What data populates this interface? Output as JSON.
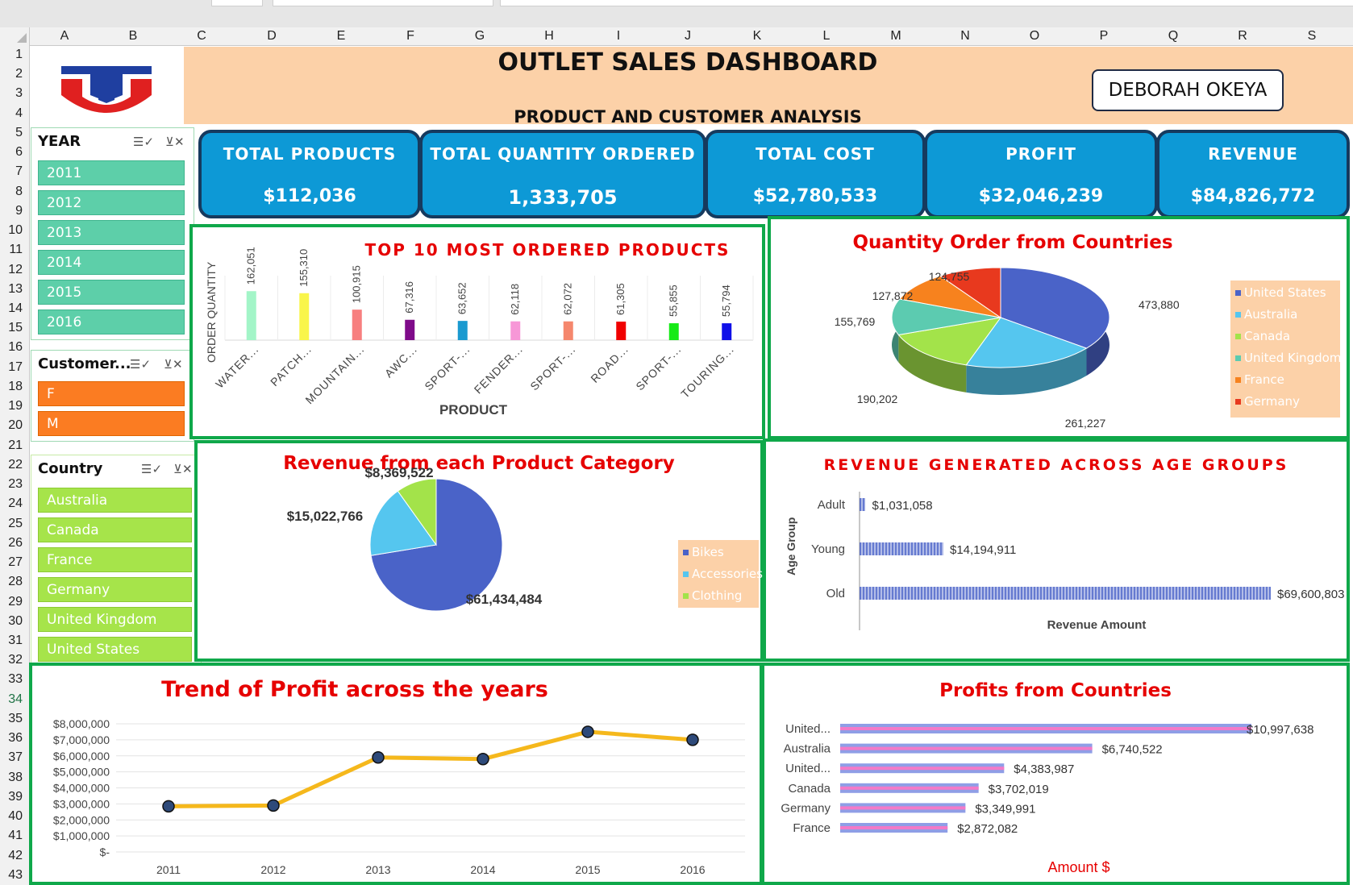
{
  "spreadsheet": {
    "columns": [
      "A",
      "B",
      "C",
      "D",
      "E",
      "F",
      "G",
      "H",
      "I",
      "J",
      "K",
      "L",
      "M",
      "N",
      "O",
      "P",
      "Q",
      "R",
      "S"
    ],
    "rows": [
      "1",
      "2",
      "3",
      "4",
      "5",
      "6",
      "7",
      "8",
      "9",
      "10",
      "11",
      "12",
      "13",
      "14",
      "15",
      "16",
      "17",
      "18",
      "19",
      "20",
      "21",
      "22",
      "23",
      "24",
      "25",
      "26",
      "27",
      "28",
      "29",
      "30",
      "31",
      "32",
      "33",
      "34",
      "35",
      "36",
      "37",
      "38",
      "39",
      "40",
      "41",
      "42",
      "43"
    ],
    "selected_row": "34"
  },
  "header": {
    "title": "OUTLET SALES DASHBOARD",
    "subtitle": "PRODUCT AND CUSTOMER ANALYSIS",
    "author": "DEBORAH OKEYA",
    "band_color": "#fcd1a8"
  },
  "kpis": [
    {
      "label": "TOTAL PRODUCTS",
      "value": "$112,036"
    },
    {
      "label": "TOTAL QUANTITY ORDERED",
      "value": "1,333,705"
    },
    {
      "label": "TOTAL COST",
      "value": "$52,780,533"
    },
    {
      "label": "PROFIT",
      "value": "$32,046,239"
    },
    {
      "label": "REVENUE",
      "value": "$84,826,772"
    }
  ],
  "slicers": {
    "year": {
      "title": "YEAR",
      "items": [
        "2011",
        "2012",
        "2013",
        "2014",
        "2015",
        "2016"
      ]
    },
    "gender": {
      "title": "Customer...",
      "items": [
        "F",
        "M"
      ]
    },
    "country": {
      "title": "Country",
      "items": [
        "Australia",
        "Canada",
        "France",
        "Germany",
        "United Kingdom",
        "United States"
      ]
    },
    "icons": [
      "multi-select-icon",
      "clear-filter-icon"
    ]
  },
  "chart_data": [
    {
      "type": "bar",
      "title": "TOP 10 MOST ORDERED PRODUCTS",
      "xlabel": "PRODUCT",
      "ylabel": "ORDER QUANTITY",
      "categories": [
        "WATER...",
        "PATCH...",
        "MOUNTAIN...",
        "AWC...",
        "SPORT-...",
        "FENDER...",
        "SPORT-...",
        "ROAD...",
        "SPORT-...",
        "TOURING..."
      ],
      "values": [
        162051,
        155310,
        100915,
        67316,
        63652,
        62118,
        62072,
        61305,
        55855,
        55794
      ],
      "value_labels": [
        "162,051",
        "155,310",
        "100,915",
        "67,316",
        "63,652",
        "62,118",
        "62,072",
        "61,305",
        "55,855",
        "55,794"
      ],
      "colors": [
        "#a3f5c8",
        "#f9f54a",
        "#f77f7f",
        "#7f0b8a",
        "#1a9ad0",
        "#f797d7",
        "#f5876d",
        "#f00000",
        "#15ea15",
        "#1010e8"
      ],
      "ylim": [
        0,
        180000
      ]
    },
    {
      "type": "pie",
      "title": "Quantity Order from Countries",
      "series": [
        {
          "name": "United States",
          "value": 473880,
          "label": "473,880",
          "color": "#4a63c8"
        },
        {
          "name": "Australia",
          "value": 261227,
          "label": "261,227",
          "color": "#55c6ef"
        },
        {
          "name": "Canada",
          "value": 190202,
          "label": "190,202",
          "color": "#a3e34a"
        },
        {
          "name": "United Kingdom",
          "value": 155769,
          "label": "155,769",
          "color": "#5ccbb0"
        },
        {
          "name": "France",
          "value": 127872,
          "label": "127,872",
          "color": "#f7821e"
        },
        {
          "name": "Germany",
          "value": 124755,
          "label": "124,755",
          "color": "#e8391e"
        }
      ],
      "legend": "right"
    },
    {
      "type": "pie",
      "title": "Revenue from each Product Category",
      "series": [
        {
          "name": "Bikes",
          "value": 61434484,
          "label": "$61,434,484",
          "color": "#4a63c8"
        },
        {
          "name": "Accessories",
          "value": 15022766,
          "label": "$15,022,766",
          "color": "#55c6ef"
        },
        {
          "name": "Clothing",
          "value": 8369522,
          "label": "$8,369,522",
          "color": "#a3e34a"
        }
      ],
      "legend": "right"
    },
    {
      "type": "bar",
      "orientation": "horizontal",
      "title": "REVENUE GENERATED ACROSS AGE GROUPS",
      "xlabel": "Revenue Amount",
      "ylabel": "Age Group",
      "categories": [
        "Adult",
        "Young",
        "Old"
      ],
      "values": [
        1031058,
        14194911,
        69600803
      ],
      "value_labels": [
        "$1,031,058",
        "$14,194,911",
        "$69,600,803"
      ],
      "color": "#4a63c8"
    },
    {
      "type": "line",
      "title": "Trend of Profit across the years",
      "x": [
        "2011",
        "2012",
        "2013",
        "2014",
        "2015",
        "2016"
      ],
      "values": [
        2850000,
        2900000,
        5900000,
        5800000,
        7500000,
        7000000
      ],
      "yticks": [
        "$8,000,000",
        "$7,000,000",
        "$6,000,000",
        "$5,000,000",
        "$4,000,000",
        "$3,000,000",
        "$2,000,000",
        "$1,000,000",
        "$-"
      ],
      "ylim": [
        0,
        8000000
      ],
      "color": "#f5b81c"
    },
    {
      "type": "bar",
      "orientation": "horizontal",
      "title": "Profits from Countries",
      "xlabel": "Amount $",
      "categories": [
        "United...",
        "Australia",
        "United...",
        "Canada",
        "Germany",
        "France"
      ],
      "values": [
        10997638,
        6740522,
        4383987,
        3702019,
        3349991,
        2872082
      ],
      "value_labels": [
        "$10,997,638",
        "$6,740,522",
        "$4,383,987",
        "$3,702,019",
        "$3,349,991",
        "$2,872,082"
      ],
      "color": "#f27ac8"
    }
  ]
}
